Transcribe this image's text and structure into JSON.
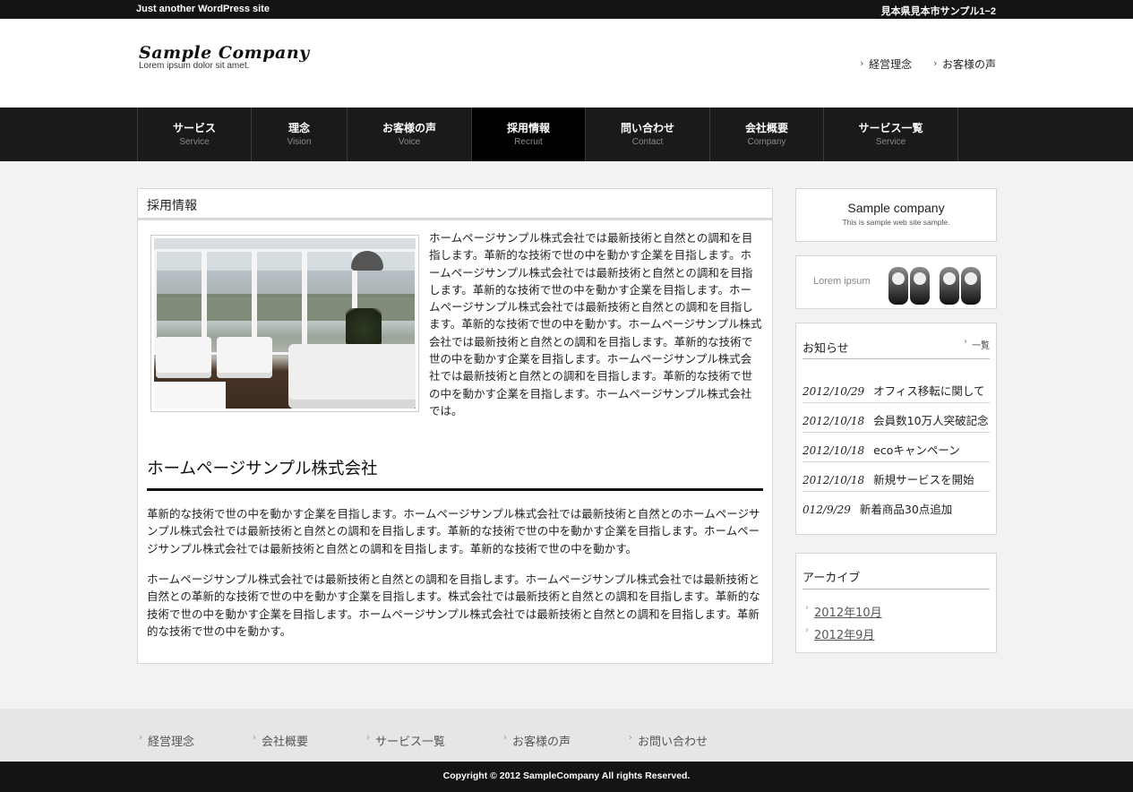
{
  "topbar": {
    "tagline": "Just another WordPress site",
    "address": "見本県見本市サンプル1−2"
  },
  "header": {
    "logo_name": "Sample Company",
    "logo_sub": "Lorem ipsum dolor sit amet.",
    "links": [
      "経営理念",
      "お客様の声"
    ]
  },
  "nav": {
    "items": [
      {
        "jp": "サービス",
        "en": "Service"
      },
      {
        "jp": "理念",
        "en": "Vision"
      },
      {
        "jp": "お客様の声",
        "en": "Voice"
      },
      {
        "jp": "採用情報",
        "en": "Recruit"
      },
      {
        "jp": "問い合わせ",
        "en": "Contact"
      },
      {
        "jp": "会社概要",
        "en": "Company"
      },
      {
        "jp": "サービス一覧",
        "en": "Service"
      }
    ],
    "active": "採用情報"
  },
  "main": {
    "page_title": "採用情報",
    "intro": "ホームページサンプル株式会社では最新技術と自然との調和を目指します。革新的な技術で世の中を動かす企業を目指します。ホームページサンプル株式会社では最新技術と自然との調和を目指します。革新的な技術で世の中を動かす企業を目指します。ホームページサンプル株式会社では最新技術と自然との調和を目指します。革新的な技術で世の中を動かす。ホームページサンプル株式会社では最新技術と自然との調和を目指します。革新的な技術で世の中を動かす企業を目指します。ホームページサンプル株式会社では最新技術と自然との調和を目指します。革新的な技術で世の中を動かす企業を目指します。ホームページサンプル株式会社では。",
    "heading": "ホームページサンプル株式会社",
    "para1": "革新的な技術で世の中を動かす企業を目指します。ホームページサンプル株式会社では最新技術と自然とのホームページサンプル株式会社では最新技術と自然との調和を目指します。革新的な技術で世の中を動かす企業を目指します。ホームページサンプル株式会社では最新技術と自然との調和を目指します。革新的な技術で世の中を動かす。",
    "para2": "ホームページサンプル株式会社では最新技術と自然との調和を目指します。ホームページサンプル株式会社では最新技術と自然との革新的な技術で世の中を動かす企業を目指します。株式会社では最新技術と自然との調和を目指します。革新的な技術で世の中を動かす企業を目指します。ホームページサンプル株式会社では最新技術と自然との調和を目指します。革新的な技術で世の中を動かす。"
  },
  "sidebar": {
    "brand_title": "Sample company",
    "brand_sub": "This is sample web site sample.",
    "banner_label": "Lorem ipsum",
    "news_title": "お知らせ",
    "news_more": "一覧",
    "news": [
      {
        "date": "2012/10/29",
        "title": "オフィス移転に関して"
      },
      {
        "date": "2012/10/18",
        "title": "会員数10万人突破記念"
      },
      {
        "date": "2012/10/18",
        "title": "ecoキャンペーン"
      },
      {
        "date": "2012/10/18",
        "title": "新規サービスを開始"
      },
      {
        "date": "012/9/29",
        "title": "新着商品30点追加"
      }
    ],
    "archive_title": "アーカイブ",
    "archive": [
      "2012年10月",
      "2012年9月"
    ]
  },
  "footer": {
    "links": [
      "経営理念",
      "会社概要",
      "サービス一覧",
      "お客様の声",
      "お問い合わせ"
    ],
    "copyright": "Copyright © 2012 SampleCompany All rights Reserved."
  }
}
